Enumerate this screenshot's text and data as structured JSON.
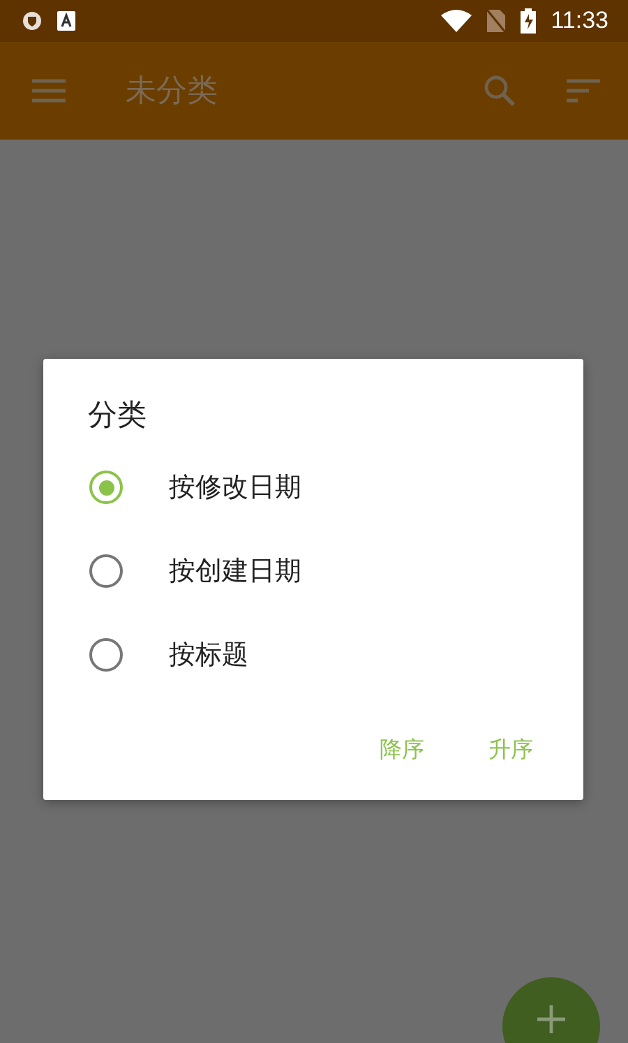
{
  "status_bar": {
    "time": "11:33"
  },
  "app_bar": {
    "title": "未分类"
  },
  "dialog": {
    "title": "分类",
    "options": [
      {
        "label": "按修改日期",
        "selected": true
      },
      {
        "label": "按创建日期",
        "selected": false
      },
      {
        "label": "按标题",
        "selected": false
      }
    ],
    "buttons": [
      "降序",
      "升序"
    ]
  }
}
